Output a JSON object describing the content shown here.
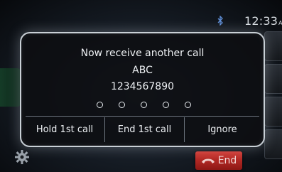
{
  "status_bar": {
    "time": "12:33",
    "ampm": "AM",
    "icons": [
      "bluetooth-icon"
    ]
  },
  "incoming_call_dialog": {
    "title": "Now receive another call",
    "caller_name": "ABC",
    "caller_number": "1234567890",
    "ring_indicator_dots": 5,
    "actions": {
      "hold": "Hold 1st call",
      "end_first": "End 1st call",
      "ignore": "Ignore"
    }
  },
  "call_controls": {
    "end_label": "End",
    "end_color": "#c42a25"
  },
  "icons": [
    "gear-icon",
    "phone-hangup-icon",
    "bluetooth-icon"
  ]
}
